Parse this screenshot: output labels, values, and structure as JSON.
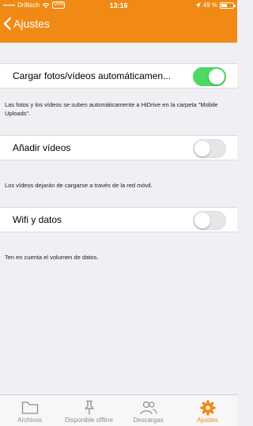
{
  "status_bar": {
    "carrier": "Drillisch",
    "network": "VPN",
    "time": "13:16",
    "battery": "49 %",
    "battery_level": 0.49
  },
  "nav": {
    "back_label": "Ajustes"
  },
  "settings": [
    {
      "label": "Cargar fotos/vídeos automáticamen...",
      "enabled": true,
      "footnote": "Las fotos y los vídeos se suben automáticamente a HiDrive en la carpeta \"Mobile Uploads\"."
    },
    {
      "label": "Añadir vídeos",
      "enabled": false,
      "footnote": "Los vídeos dejarán de cargarse a través de la red móvil."
    },
    {
      "label": "Wifi y datos",
      "enabled": false,
      "footnote": "Ten en cuenta el volumen de datos."
    }
  ],
  "tabbar": {
    "tabs": [
      {
        "label": "Archivos",
        "icon": "folder-icon"
      },
      {
        "label": "Disponible offline",
        "icon": "pin-icon"
      },
      {
        "label": "Descargas",
        "icon": "users-icon"
      },
      {
        "label": "Ajustes",
        "icon": "gear-icon"
      }
    ],
    "active_index": 3
  },
  "colors": {
    "accent": "#f08a14",
    "toggle_on": "#4cd964"
  }
}
